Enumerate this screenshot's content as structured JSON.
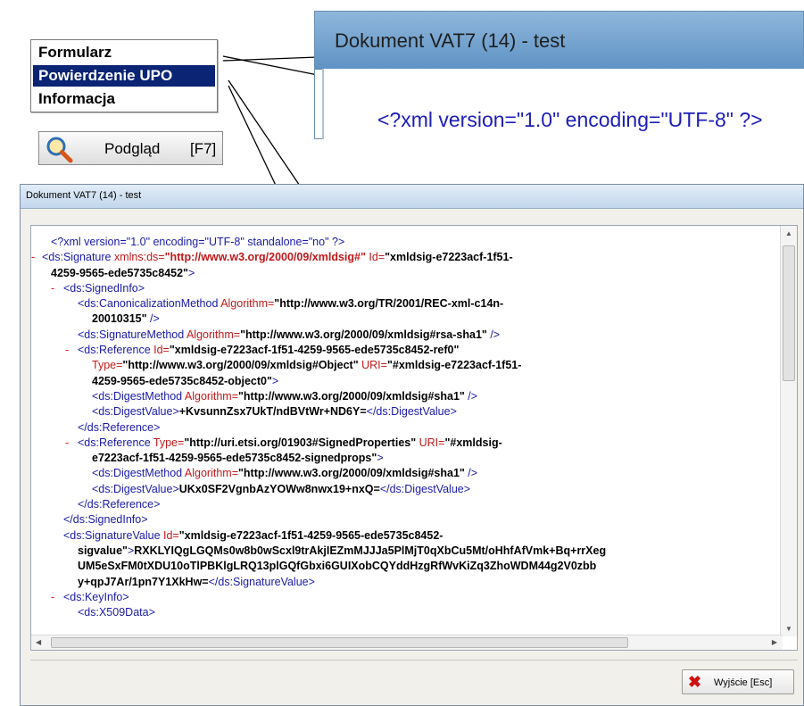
{
  "menu": {
    "items": [
      {
        "label": "Formularz"
      },
      {
        "label": "Powierdzenie UPO"
      },
      {
        "label": "Informacja"
      }
    ]
  },
  "preview_button": {
    "label": "Podgląd",
    "key": "[F7]"
  },
  "zoom": {
    "title": "Dokument VAT7 (14) - test",
    "xml_text": "<?xml version=\"1.0\" encoding=\"UTF-8\" ?>"
  },
  "dialog": {
    "title": "Dokument VAT7 (14) - test"
  },
  "exit_button": {
    "label": "Wyjście [Esc]"
  },
  "xml": {
    "l1": "<?xml version=\"1.0\" encoding=\"UTF-8\" standalone=\"no\" ?>",
    "minus": "-",
    "l2_t": "<ds:Signature",
    "l2_a": " xmlns:ds=",
    "l2_v": "\"http://www.w3.org/2000/09/xmldsig#\"",
    "l2_a2": " Id=",
    "l2_v2": "\"xmldsig-e7223acf-1f51-",
    "l3_v": "4259-9565-ede5735c8452\"",
    "l3_t": ">",
    "l4_t": "<ds:SignedInfo>",
    "l5_t": "<ds:CanonicalizationMethod",
    "l5_a": " Algorithm=",
    "l5_v": "\"http://www.w3.org/TR/2001/REC-xml-c14n-",
    "l6_v": "20010315\"",
    "l6_t": " />",
    "l7_t": "<ds:SignatureMethod",
    "l7_a": " Algorithm=",
    "l7_v": "\"http://www.w3.org/2000/09/xmldsig#rsa-sha1\"",
    "l7_t2": " />",
    "l8_t": "<ds:Reference",
    "l8_a": " Id=",
    "l8_v": "\"xmldsig-e7223acf-1f51-4259-9565-ede5735c8452-ref0\"",
    "l9_a": "Type=",
    "l9_v": "\"http://www.w3.org/2000/09/xmldsig#Object\"",
    "l9_a2": " URI=",
    "l9_v2": "\"#xmldsig-e7223acf-1f51-",
    "l10_v": "4259-9565-ede5735c8452-object0\"",
    "l10_t": ">",
    "l11_t": "<ds:DigestMethod",
    "l11_a": " Algorithm=",
    "l11_v": "\"http://www.w3.org/2000/09/xmldsig#sha1\"",
    "l11_t2": " />",
    "l12_t": "<ds:DigestValue>",
    "l12_c": "+KvsunnZsx7UkT/ndBVtWr+ND6Y=",
    "l12_t2": "</ds:DigestValue>",
    "l13_t": "</ds:Reference>",
    "l14_t": "<ds:Reference",
    "l14_a": " Type=",
    "l14_v": "\"http://uri.etsi.org/01903#SignedProperties\"",
    "l14_a2": " URI=",
    "l14_v2": "\"#xmldsig-",
    "l15_v": "e7223acf-1f51-4259-9565-ede5735c8452-signedprops\"",
    "l15_t": ">",
    "l16_t": "<ds:DigestMethod",
    "l16_a": " Algorithm=",
    "l16_v": "\"http://www.w3.org/2000/09/xmldsig#sha1\"",
    "l16_t2": " />",
    "l17_t": "<ds:DigestValue>",
    "l17_c": "UKx0SF2VgnbAzYOWw8nwx19+nxQ=",
    "l17_t2": "</ds:DigestValue>",
    "l18_t": "</ds:Reference>",
    "l19_t": "</ds:SignedInfo>",
    "l20_t": "<ds:SignatureValue",
    "l20_a": " Id=",
    "l20_v": "\"xmldsig-e7223acf-1f51-4259-9565-ede5735c8452-",
    "l21_v": "sigvalue\"",
    "l21_t": ">",
    "l21_c": "RXKLYIQgLGQMs0w8b0wScxl9trAkjIEZmMJJJa5PlMjT0qXbCu5Mt/oHhfAfVmk+Bq+rrXeg",
    "l22_c": "UM5eSxFM0tXDU10oTlPBKlgLRQ13plGQfGbxi6GUIXobCQYddHzgRfWvKiZq3ZhoWDM44g2V0zbb",
    "l23_c": "y+qpJ7Ar/1pn7Y1XkHw=",
    "l23_t": "</ds:SignatureValue>",
    "l24_t": "<ds:KeyInfo>",
    "l25_t": "<ds:X509Data>"
  }
}
